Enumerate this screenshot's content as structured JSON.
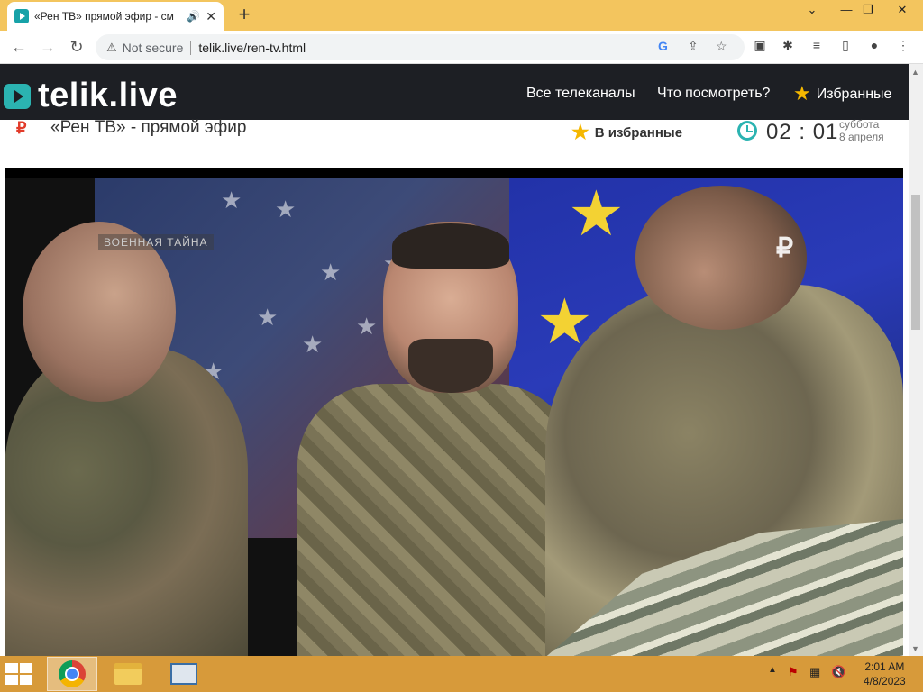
{
  "browser": {
    "tab_title": "«Рен ТВ» прямой эфир - см",
    "tab_audio_icon": "speaker-icon",
    "new_tab": "+",
    "security_label": "Not secure",
    "url": "telik.live/ren-tv.html",
    "window": {
      "minimize": "⌄",
      "restore": "—",
      "maximize": "❐",
      "close": "✕"
    }
  },
  "site": {
    "logo": "telik.live",
    "nav": [
      "Все телеканалы",
      "Что посмотреть?",
      "Избранные"
    ]
  },
  "channel": {
    "logo_text": "₽",
    "title": "«Рен ТВ» - прямой эфир",
    "favorite_label": "В избранные",
    "time": "02 : 01",
    "weekday": "суббота",
    "date": "8 апреля"
  },
  "video": {
    "overlay_badge": "ВОЕННАЯ ТАЙНА",
    "watermark": "₽"
  },
  "taskbar": {
    "clock_time": "2:01 AM",
    "clock_date": "4/8/2023"
  }
}
